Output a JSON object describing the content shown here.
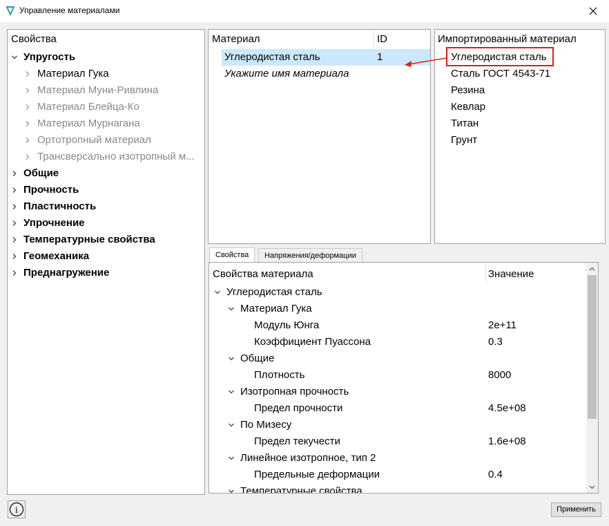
{
  "window": {
    "title": "Управление материалами"
  },
  "colors": {
    "selection": "#cce8ff",
    "annotation": "#e01b1b",
    "disabled_text": "#888888"
  },
  "properties_tree": {
    "header": "Свойства",
    "items": [
      {
        "label": "Упругость",
        "expanded": true,
        "bold": true,
        "level": 0
      },
      {
        "label": "Материал Гука",
        "bold": false,
        "level": 1,
        "enabled": true
      },
      {
        "label": "Материал Муни-Ривлина",
        "level": 1,
        "enabled": false
      },
      {
        "label": "Материал Блейца-Ко",
        "level": 1,
        "enabled": false
      },
      {
        "label": "Материал Мурнагана",
        "level": 1,
        "enabled": false
      },
      {
        "label": "Ортотропный материал",
        "level": 1,
        "enabled": false
      },
      {
        "label": "Трансверсально изотропный м...",
        "level": 1,
        "enabled": false
      },
      {
        "label": "Общие",
        "bold": true,
        "level": 0
      },
      {
        "label": "Прочность",
        "bold": true,
        "level": 0
      },
      {
        "label": "Пластичность",
        "bold": true,
        "level": 0
      },
      {
        "label": "Упрочнение",
        "bold": true,
        "level": 0
      },
      {
        "label": "Температурные свойства",
        "bold": true,
        "level": 0
      },
      {
        "label": "Геомеханика",
        "bold": true,
        "level": 0
      },
      {
        "label": "Преднагружение",
        "bold": true,
        "level": 0
      }
    ]
  },
  "materials_table": {
    "columns": [
      "Материал",
      "ID"
    ],
    "rows": [
      {
        "name": "Углеродистая сталь",
        "id": "1",
        "selected": true
      },
      {
        "name": "Укажите имя материала",
        "id": "",
        "placeholder": true
      }
    ]
  },
  "imported_materials": {
    "header": "Импортированный материал",
    "items": [
      "Углеродистая сталь",
      "Сталь ГОСТ 4543-71",
      "Резина",
      "Кевлар",
      "Титан",
      "Грунт"
    ]
  },
  "tabs": [
    {
      "label": "Свойства",
      "active": true
    },
    {
      "label": "Напряжения/деформации",
      "active": false
    }
  ],
  "properties_table": {
    "columns": [
      "Свойства материала",
      "Значение"
    ],
    "rows": [
      {
        "label": "Углеродистая сталь",
        "value": "",
        "level": 0,
        "expandable": true
      },
      {
        "label": "Материал Гука",
        "value": "",
        "level": 1,
        "expandable": true
      },
      {
        "label": "Модуль Юнга",
        "value": "2e+11",
        "level": 2
      },
      {
        "label": "Коэффициент Пуассона",
        "value": "0.3",
        "level": 2
      },
      {
        "label": "Общие",
        "value": "",
        "level": 1,
        "expandable": true
      },
      {
        "label": "Плотность",
        "value": "8000",
        "level": 2
      },
      {
        "label": "Изотропная прочность",
        "value": "",
        "level": 1,
        "expandable": true
      },
      {
        "label": "Предел прочности",
        "value": "4.5e+08",
        "level": 2
      },
      {
        "label": "По Мизесу",
        "value": "",
        "level": 1,
        "expandable": true
      },
      {
        "label": "Предел текучести",
        "value": "1.6e+08",
        "level": 2
      },
      {
        "label": "Линейное изотропное, тип 2",
        "value": "",
        "level": 1,
        "expandable": true
      },
      {
        "label": "Предельные деформации",
        "value": "0.4",
        "level": 2
      },
      {
        "label": "Температурные свойства",
        "value": "",
        "level": 1,
        "expandable": true
      }
    ]
  },
  "buttons": {
    "apply": "Применить",
    "info_glyph": "i"
  },
  "icons": {
    "app": "app-logo-icon",
    "close": "close-icon",
    "info": "info-icon",
    "expand": "chevron-down-icon",
    "collapse": "chevron-right-icon"
  }
}
